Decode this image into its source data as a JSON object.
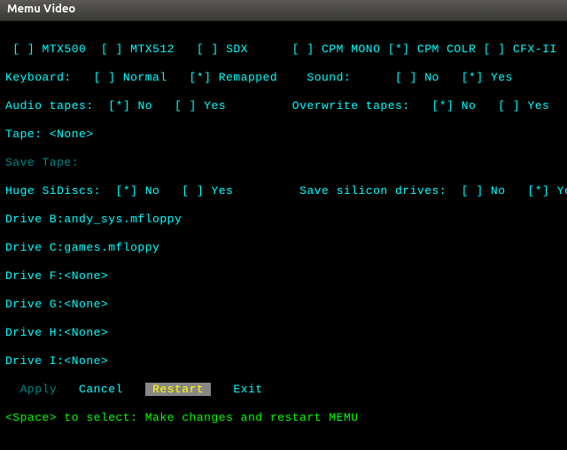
{
  "title": "Memu Video",
  "modes": {
    "mtx500": {
      "label": "MTX500",
      "checked": false
    },
    "mtx512": {
      "label": "MTX512",
      "checked": false
    },
    "sdx": {
      "label": "SDX",
      "checked": false
    },
    "cpmmono": {
      "label": "CPM MONO",
      "checked": false
    },
    "cpmcolr": {
      "label": "CPM COLR",
      "checked": true
    },
    "cfx2": {
      "label": "CFX-II",
      "checked": false
    }
  },
  "keyboard": {
    "label": "Keyboard:",
    "normal": "Normal",
    "remapped": "Remapped",
    "normal_checked": false,
    "remapped_checked": true
  },
  "sound": {
    "label": "Sound:",
    "no": "No",
    "yes": "Yes",
    "no_checked": false,
    "yes_checked": true
  },
  "audio": {
    "label": "Audio tapes:",
    "no": "No",
    "yes": "Yes",
    "no_checked": true,
    "yes_checked": false
  },
  "overwrite": {
    "label": "Overwrite tapes:",
    "no": "No",
    "yes": "Yes",
    "no_checked": true,
    "yes_checked": false
  },
  "tape": {
    "label": "Tape:",
    "value": "<None>"
  },
  "savetape": {
    "label": "Save Tape:"
  },
  "huge": {
    "label": "Huge SiDiscs:",
    "no": "No",
    "yes": "Yes",
    "no_checked": true,
    "yes_checked": false
  },
  "savesilicon": {
    "label": "Save silicon drives:",
    "no": "No",
    "yes": "Yes",
    "no_checked": false,
    "yes_checked": true
  },
  "drives": {
    "b": {
      "label": "Drive B:",
      "value": "andy_sys.mfloppy"
    },
    "c": {
      "label": "Drive C:",
      "value": "games.mfloppy"
    },
    "f": {
      "label": "Drive F:",
      "value": "<None>"
    },
    "g": {
      "label": "Drive G:",
      "value": "<None>"
    },
    "h": {
      "label": "Drive H:",
      "value": "<None>"
    },
    "i": {
      "label": "Drive I:",
      "value": "<None>"
    }
  },
  "actions": {
    "apply": "Apply",
    "cancel": "Cancel",
    "restart": "Restart",
    "exit": "Exit"
  },
  "hint": {
    "prefix": "<Space>",
    "rest": " to select: Make changes and restart MEMU"
  }
}
